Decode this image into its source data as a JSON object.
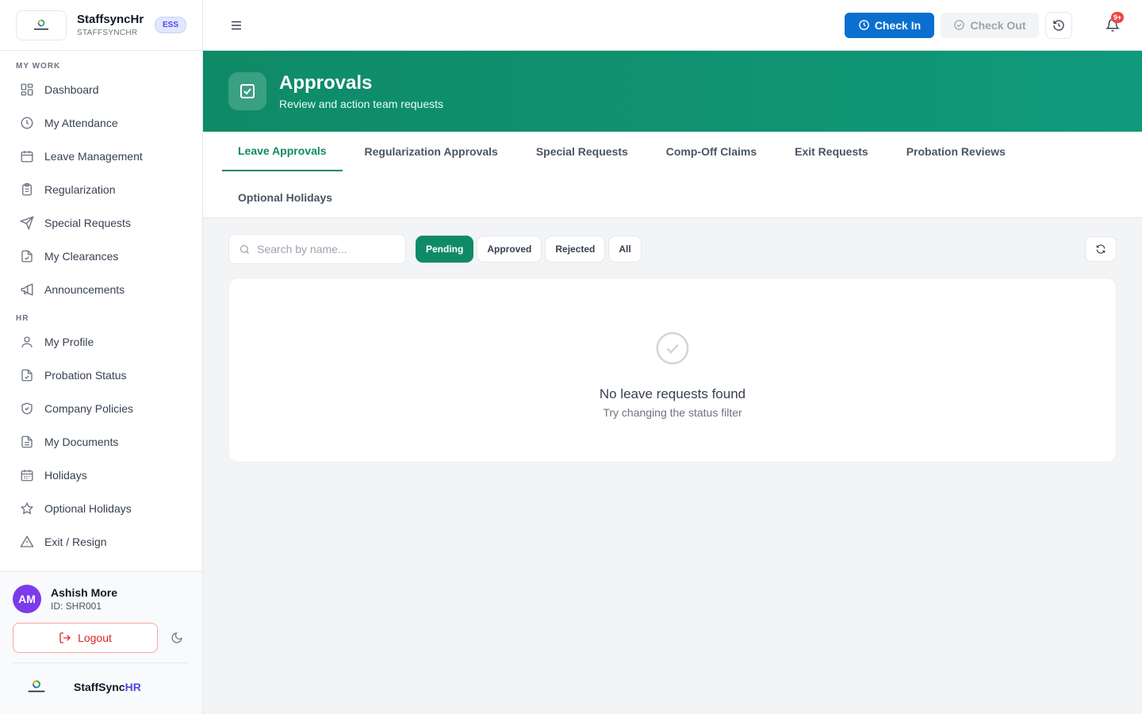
{
  "brand": {
    "name": "StaffsyncHr",
    "sub": "STAFFSYNCHR",
    "badge": "ESS"
  },
  "sidebar": {
    "my_work_label": "MY WORK",
    "my_work": [
      {
        "label": "Dashboard",
        "icon": "grid-icon"
      },
      {
        "label": "My Attendance",
        "icon": "clock-icon"
      },
      {
        "label": "Leave Management",
        "icon": "calendar-icon"
      },
      {
        "label": "Regularization",
        "icon": "clipboard-icon"
      },
      {
        "label": "Special Requests",
        "icon": "send-icon"
      },
      {
        "label": "My Clearances",
        "icon": "file-check-icon"
      },
      {
        "label": "Announcements",
        "icon": "megaphone-icon"
      }
    ],
    "hr_label": "HR",
    "hr": [
      {
        "label": "My Profile",
        "icon": "user-icon"
      },
      {
        "label": "Probation Status",
        "icon": "file-check-icon"
      },
      {
        "label": "Company Policies",
        "icon": "shield-check-icon"
      },
      {
        "label": "My Documents",
        "icon": "document-icon"
      },
      {
        "label": "Holidays",
        "icon": "calendar-grid-icon"
      },
      {
        "label": "Optional Holidays",
        "icon": "star-icon"
      },
      {
        "label": "Exit / Resign",
        "icon": "warning-icon"
      }
    ]
  },
  "user": {
    "initials": "AM",
    "name": "Ashish More",
    "id": "ID: SHR001",
    "logout": "Logout"
  },
  "footer": {
    "name": "StaffSync",
    "name_suffix": "HR"
  },
  "topbar": {
    "check_in": "Check In",
    "check_out": "Check Out",
    "notifications": "9+"
  },
  "banner": {
    "title": "Approvals",
    "subtitle": "Review and action team requests"
  },
  "tabs": [
    "Leave Approvals",
    "Regularization Approvals",
    "Special Requests",
    "Comp-Off Claims",
    "Exit Requests",
    "Probation Reviews",
    "Optional Holidays"
  ],
  "filters": {
    "search_placeholder": "Search by name...",
    "statuses": [
      "Pending",
      "Approved",
      "Rejected",
      "All"
    ],
    "active_status": "Pending"
  },
  "empty": {
    "title": "No leave requests found",
    "subtitle": "Try changing the status filter"
  },
  "colors": {
    "primary_green": "#0f8a66",
    "check_in_blue": "#0b6fd0",
    "avatar_purple": "#7c3aed",
    "danger": "#dc2626"
  }
}
